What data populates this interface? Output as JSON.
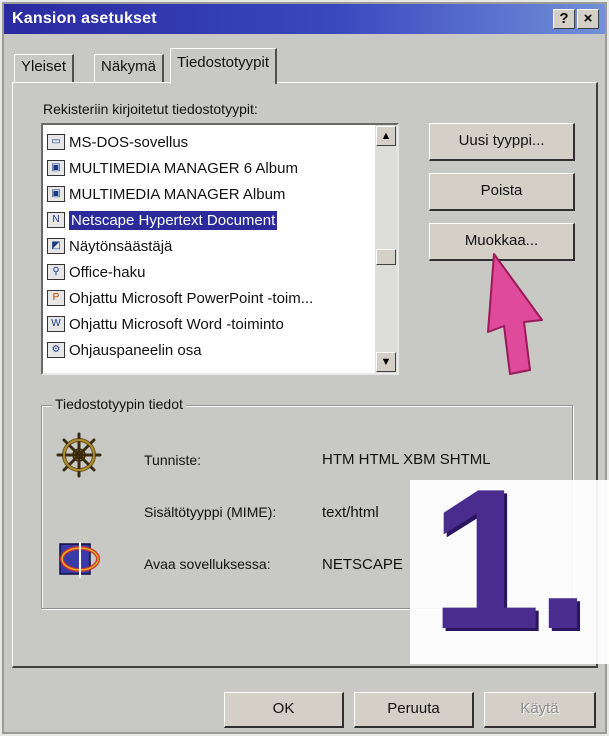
{
  "window": {
    "title": "Kansion asetukset",
    "help_button": "?",
    "close_button": "×"
  },
  "tabs": [
    {
      "label": "Yleiset",
      "active": false
    },
    {
      "label": "Näkymä",
      "active": false
    },
    {
      "label": "Tiedostotyypit",
      "active": true
    }
  ],
  "file_types": {
    "label": "Rekisteriin kirjoitetut tiedostotyypit:",
    "items": [
      {
        "label": "MS-DOS-sovellus",
        "icon": "dos-window-icon",
        "selected": false
      },
      {
        "label": "MULTIMEDIA MANAGER 6 Album",
        "icon": "album-icon",
        "selected": false
      },
      {
        "label": "MULTIMEDIA MANAGER Album",
        "icon": "album-icon",
        "selected": false
      },
      {
        "label": "Netscape Hypertext Document",
        "icon": "netscape-document-icon",
        "selected": true
      },
      {
        "label": "Näytönsäästäjä",
        "icon": "screensaver-icon",
        "selected": false
      },
      {
        "label": "Office-haku",
        "icon": "office-search-icon",
        "selected": false
      },
      {
        "label": "Ohjattu Microsoft PowerPoint -toim...",
        "icon": "powerpoint-icon",
        "selected": false
      },
      {
        "label": "Ohjattu Microsoft Word -toiminto",
        "icon": "word-icon",
        "selected": false
      },
      {
        "label": "Ohjauspaneelin osa",
        "icon": "control-panel-icon",
        "selected": false
      }
    ]
  },
  "actions": {
    "new_type": "Uusi tyyppi...",
    "remove": "Poista",
    "edit": "Muokkaa..."
  },
  "details": {
    "title": "Tiedostotyypin tiedot",
    "extension_label": "Tunniste:",
    "extension_value": "HTM HTML XBM SHTML",
    "mime_label": "Sisältötyyppi (MIME):",
    "mime_value": "text/html",
    "open_with_label": "Avaa sovelluksessa:",
    "open_with_value": "NETSCAPE"
  },
  "step_number": "1.",
  "footer": {
    "ok": "OK",
    "cancel": "Peruuta",
    "apply": "Käytä"
  },
  "colors": {
    "titlebar": "#2a2aa0",
    "selection": "#2a2a9a",
    "step_number": "#4a2c8e",
    "pointer": "#e04a9a"
  }
}
